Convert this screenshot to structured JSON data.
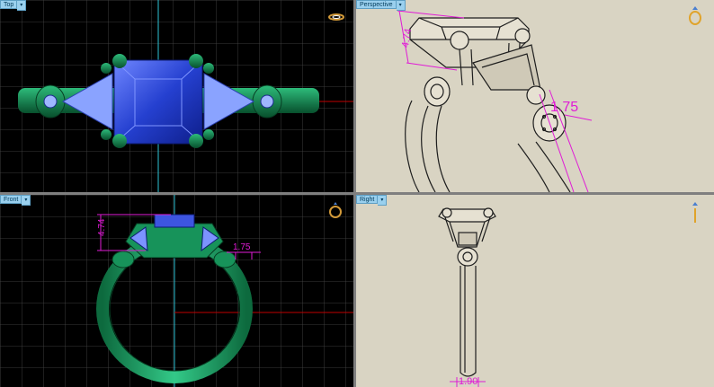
{
  "viewports": {
    "top": {
      "label": "Top"
    },
    "perspective": {
      "label": "Perspective"
    },
    "front": {
      "label": "Front"
    },
    "right": {
      "label": "Right"
    }
  },
  "icons": {
    "menu": "dropdown-arrow-icon",
    "widget": "ring-preview-icon"
  },
  "dimensions": {
    "perspective_height": "4.74",
    "perspective_width": "1.75",
    "front_height": "4.74",
    "front_width": "1.75",
    "right_width": "1.90"
  },
  "colors": {
    "dimension": "#e01bd6",
    "grid_major": "#6a6a6a",
    "axis_red": "#c00000",
    "axis_cyan": "#2ec5d6",
    "metal": "#0f7f4a",
    "gem": "#2540d0",
    "paper": "#d9d4c3"
  }
}
